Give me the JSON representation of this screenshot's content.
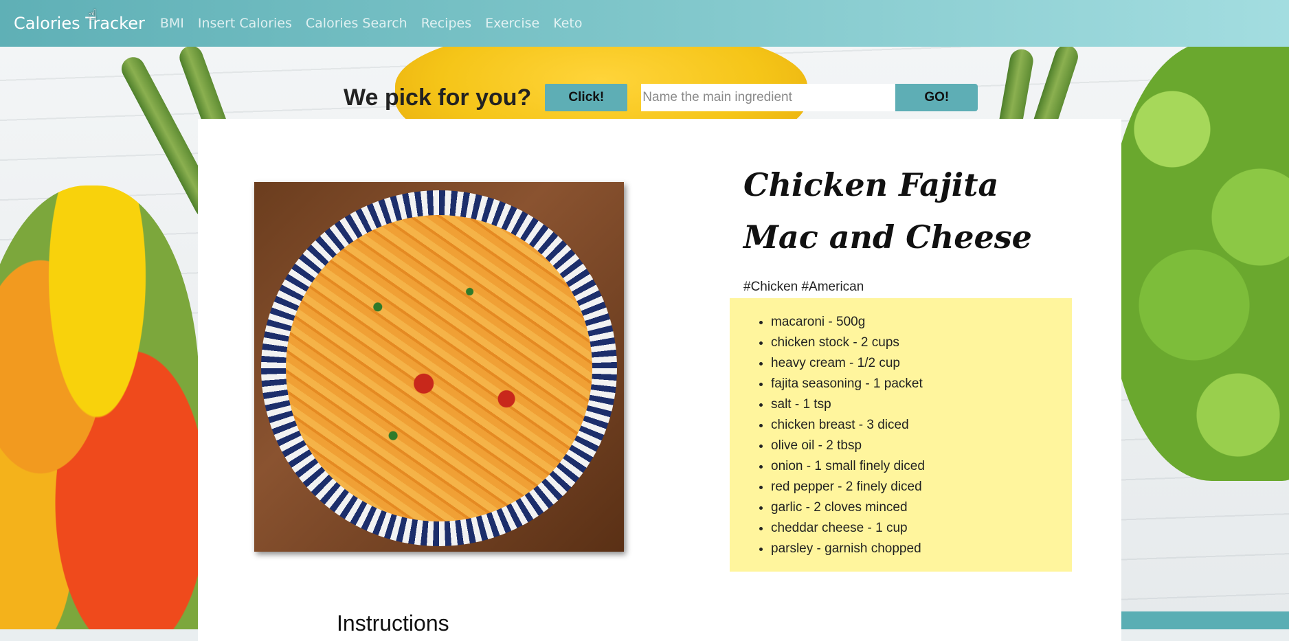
{
  "navbar": {
    "brand": "Calories Tracker",
    "links": [
      "BMI",
      "Insert Calories",
      "Calories Search",
      "Recipes",
      "Exercise",
      "Keto"
    ]
  },
  "picker": {
    "title": "We pick for you?",
    "click_label": "Click!",
    "search_placeholder": "Name the main ingredient",
    "go_label": "GO!"
  },
  "recipe": {
    "title": "Chicken Fajita Mac and Cheese",
    "tags": "#Chicken #American",
    "ingredients": [
      "macaroni - 500g",
      "chicken stock - 2 cups",
      "heavy cream - 1/2 cup",
      "fajita seasoning - 1 packet",
      "salt - 1 tsp",
      "chicken breast - 3 diced",
      "olive oil - 2 tbsp",
      "onion - 1 small finely diced",
      "red pepper - 2 finely diced",
      "garlic - 2 cloves minced",
      "cheddar cheese - 1 cup",
      "parsley - garnish chopped"
    ],
    "instructions_heading": "Instructions"
  },
  "colors": {
    "navbar": "#5fb0b6",
    "button": "#5eaeb5",
    "ingredients_bg": "#fff59d"
  }
}
